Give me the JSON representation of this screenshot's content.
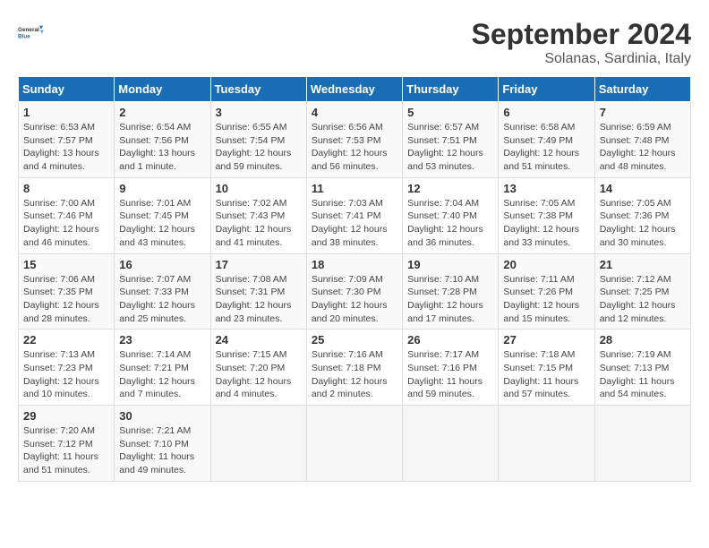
{
  "header": {
    "logo_general": "General",
    "logo_blue": "Blue",
    "title": "September 2024",
    "location": "Solanas, Sardinia, Italy"
  },
  "columns": [
    "Sunday",
    "Monday",
    "Tuesday",
    "Wednesday",
    "Thursday",
    "Friday",
    "Saturday"
  ],
  "weeks": [
    [
      {
        "day": "1",
        "sunrise": "6:53 AM",
        "sunset": "7:57 PM",
        "daylight": "13 hours and 4 minutes."
      },
      {
        "day": "2",
        "sunrise": "6:54 AM",
        "sunset": "7:56 PM",
        "daylight": "13 hours and 1 minute."
      },
      {
        "day": "3",
        "sunrise": "6:55 AM",
        "sunset": "7:54 PM",
        "daylight": "12 hours and 59 minutes."
      },
      {
        "day": "4",
        "sunrise": "6:56 AM",
        "sunset": "7:53 PM",
        "daylight": "12 hours and 56 minutes."
      },
      {
        "day": "5",
        "sunrise": "6:57 AM",
        "sunset": "7:51 PM",
        "daylight": "12 hours and 53 minutes."
      },
      {
        "day": "6",
        "sunrise": "6:58 AM",
        "sunset": "7:49 PM",
        "daylight": "12 hours and 51 minutes."
      },
      {
        "day": "7",
        "sunrise": "6:59 AM",
        "sunset": "7:48 PM",
        "daylight": "12 hours and 48 minutes."
      }
    ],
    [
      {
        "day": "8",
        "sunrise": "7:00 AM",
        "sunset": "7:46 PM",
        "daylight": "12 hours and 46 minutes."
      },
      {
        "day": "9",
        "sunrise": "7:01 AM",
        "sunset": "7:45 PM",
        "daylight": "12 hours and 43 minutes."
      },
      {
        "day": "10",
        "sunrise": "7:02 AM",
        "sunset": "7:43 PM",
        "daylight": "12 hours and 41 minutes."
      },
      {
        "day": "11",
        "sunrise": "7:03 AM",
        "sunset": "7:41 PM",
        "daylight": "12 hours and 38 minutes."
      },
      {
        "day": "12",
        "sunrise": "7:04 AM",
        "sunset": "7:40 PM",
        "daylight": "12 hours and 36 minutes."
      },
      {
        "day": "13",
        "sunrise": "7:05 AM",
        "sunset": "7:38 PM",
        "daylight": "12 hours and 33 minutes."
      },
      {
        "day": "14",
        "sunrise": "7:05 AM",
        "sunset": "7:36 PM",
        "daylight": "12 hours and 30 minutes."
      }
    ],
    [
      {
        "day": "15",
        "sunrise": "7:06 AM",
        "sunset": "7:35 PM",
        "daylight": "12 hours and 28 minutes."
      },
      {
        "day": "16",
        "sunrise": "7:07 AM",
        "sunset": "7:33 PM",
        "daylight": "12 hours and 25 minutes."
      },
      {
        "day": "17",
        "sunrise": "7:08 AM",
        "sunset": "7:31 PM",
        "daylight": "12 hours and 23 minutes."
      },
      {
        "day": "18",
        "sunrise": "7:09 AM",
        "sunset": "7:30 PM",
        "daylight": "12 hours and 20 minutes."
      },
      {
        "day": "19",
        "sunrise": "7:10 AM",
        "sunset": "7:28 PM",
        "daylight": "12 hours and 17 minutes."
      },
      {
        "day": "20",
        "sunrise": "7:11 AM",
        "sunset": "7:26 PM",
        "daylight": "12 hours and 15 minutes."
      },
      {
        "day": "21",
        "sunrise": "7:12 AM",
        "sunset": "7:25 PM",
        "daylight": "12 hours and 12 minutes."
      }
    ],
    [
      {
        "day": "22",
        "sunrise": "7:13 AM",
        "sunset": "7:23 PM",
        "daylight": "12 hours and 10 minutes."
      },
      {
        "day": "23",
        "sunrise": "7:14 AM",
        "sunset": "7:21 PM",
        "daylight": "12 hours and 7 minutes."
      },
      {
        "day": "24",
        "sunrise": "7:15 AM",
        "sunset": "7:20 PM",
        "daylight": "12 hours and 4 minutes."
      },
      {
        "day": "25",
        "sunrise": "7:16 AM",
        "sunset": "7:18 PM",
        "daylight": "12 hours and 2 minutes."
      },
      {
        "day": "26",
        "sunrise": "7:17 AM",
        "sunset": "7:16 PM",
        "daylight": "11 hours and 59 minutes."
      },
      {
        "day": "27",
        "sunrise": "7:18 AM",
        "sunset": "7:15 PM",
        "daylight": "11 hours and 57 minutes."
      },
      {
        "day": "28",
        "sunrise": "7:19 AM",
        "sunset": "7:13 PM",
        "daylight": "11 hours and 54 minutes."
      }
    ],
    [
      {
        "day": "29",
        "sunrise": "7:20 AM",
        "sunset": "7:12 PM",
        "daylight": "11 hours and 51 minutes."
      },
      {
        "day": "30",
        "sunrise": "7:21 AM",
        "sunset": "7:10 PM",
        "daylight": "11 hours and 49 minutes."
      },
      null,
      null,
      null,
      null,
      null
    ]
  ]
}
